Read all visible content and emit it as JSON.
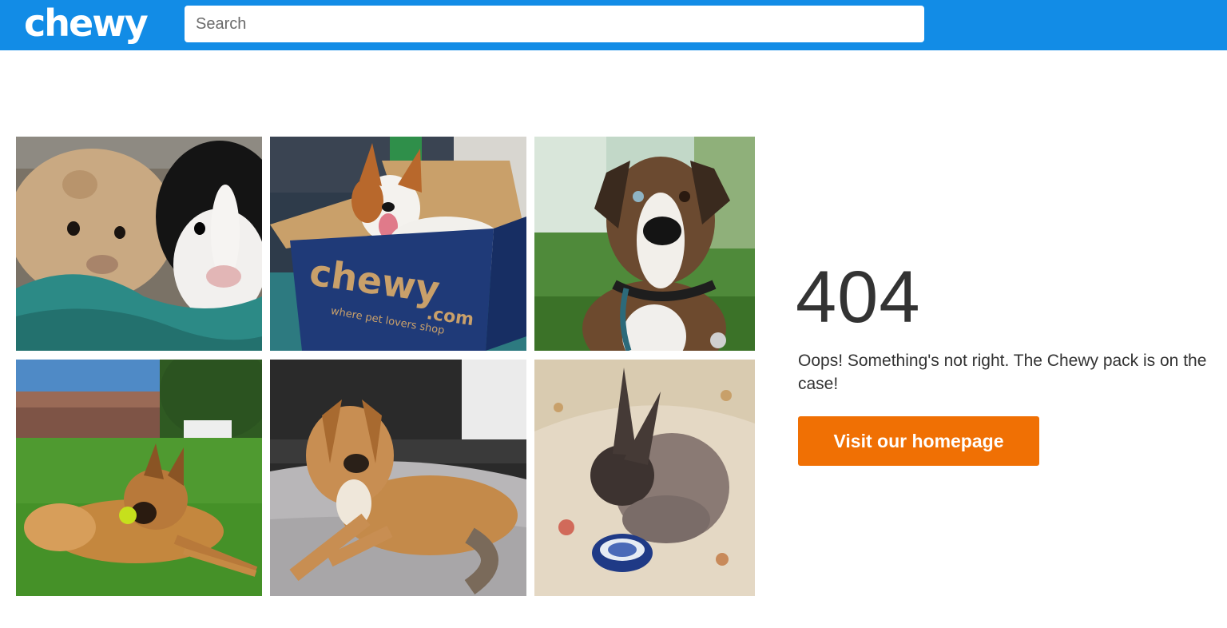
{
  "header": {
    "logo_text": "chewy",
    "search_placeholder": "Search",
    "background_color": "#128ce6"
  },
  "gallery": {
    "photos": [
      {
        "subject": "two guinea pigs on a teal blanket"
      },
      {
        "subject": "dog sitting in a chewy.com shipping box"
      },
      {
        "subject": "brindle dog with collar outdoors"
      },
      {
        "subject": "long-haired dog with tennis ball on grass"
      },
      {
        "subject": "tan dog lying on a dog bed"
      },
      {
        "subject": "rabbit next to a blue patterned bowl"
      }
    ],
    "box_print": {
      "brand": "chewy",
      "domain": ".com",
      "tagline": "where pet lovers shop"
    }
  },
  "error": {
    "code": "404",
    "message": "Oops! Something's not right. The Chewy pack is on the case!",
    "button_label": "Visit our homepage",
    "button_color": "#f07004"
  }
}
